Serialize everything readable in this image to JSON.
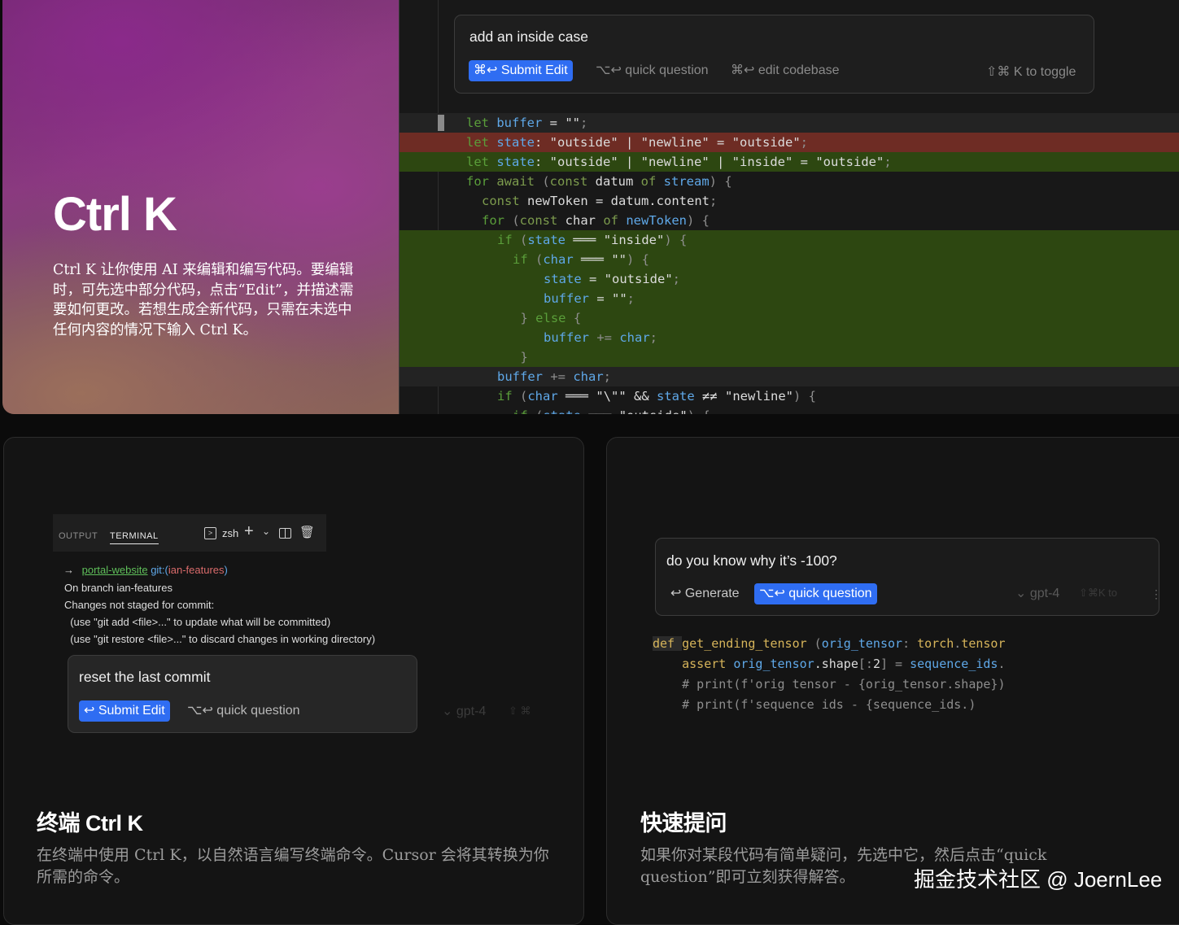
{
  "hero": {
    "title": "Ctrl K",
    "description": "Ctrl K 让你使用 AI 来编辑和编写代码。要编辑时，可先选中部分代码，点击“Edit”，并描述需要如何更改。若想生成全新代码，只需在未选中任何内容的情况下输入 Ctrl K。"
  },
  "editor": {
    "prompt": "add an inside case",
    "submit_label": "⌘↩ Submit Edit",
    "quick_question_label": "⌥↩ quick question",
    "edit_codebase_label": "⌘↩ edit codebase",
    "toggle_hint": "⇧⌘ K to toggle",
    "code_lines": [
      {
        "state": "hi",
        "indent": 0,
        "tokens": [
          [
            "kw",
            "let "
          ],
          [
            "vr",
            "buffer"
          ],
          [
            "pl",
            " = "
          ],
          [
            "st",
            "\"\""
          ],
          [
            "pu",
            ";"
          ]
        ]
      },
      {
        "state": "del",
        "indent": 0,
        "tokens": [
          [
            "kw",
            "let "
          ],
          [
            "vr",
            "state"
          ],
          [
            "pl",
            ": "
          ],
          [
            "st",
            "\"outside\""
          ],
          [
            "pl",
            " | "
          ],
          [
            "st",
            "\"newline\""
          ],
          [
            "pl",
            " = "
          ],
          [
            "st",
            "\"outside\""
          ],
          [
            "pu",
            ";"
          ]
        ]
      },
      {
        "state": "add",
        "indent": 0,
        "tokens": [
          [
            "kw",
            "let "
          ],
          [
            "vr",
            "state"
          ],
          [
            "pl",
            ": "
          ],
          [
            "st",
            "\"outside\""
          ],
          [
            "pl",
            " | "
          ],
          [
            "st",
            "\"newline\""
          ],
          [
            "pl",
            " | "
          ],
          [
            "st",
            "\"inside\""
          ],
          [
            "pl",
            " = "
          ],
          [
            "st",
            "\"outside\""
          ],
          [
            "pu",
            ";"
          ]
        ]
      },
      {
        "state": "",
        "indent": 0,
        "tokens": [
          [
            "kw",
            "for "
          ],
          [
            "kwd",
            "await "
          ],
          [
            "pu",
            "("
          ],
          [
            "kwd",
            "const "
          ],
          [
            "pl",
            "datum "
          ],
          [
            "kwd",
            "of "
          ],
          [
            "vr",
            "stream"
          ],
          [
            "pu",
            ") {"
          ]
        ]
      },
      {
        "state": "",
        "indent": 1,
        "tokens": [
          [
            "kwd",
            "const "
          ],
          [
            "pl",
            "newToken"
          ],
          [
            "pl",
            " = datum."
          ],
          [
            "pl",
            "content"
          ],
          [
            "pu",
            ";"
          ]
        ]
      },
      {
        "state": "",
        "indent": 1,
        "tokens": [
          [
            "kw",
            "for "
          ],
          [
            "pu",
            "("
          ],
          [
            "kwd",
            "const "
          ],
          [
            "pl",
            "char "
          ],
          [
            "kwd",
            "of "
          ],
          [
            "vr",
            "newToken"
          ],
          [
            "pu",
            ") {"
          ]
        ]
      },
      {
        "state": "add",
        "indent": 2,
        "tokens": [
          [
            "kw",
            "if "
          ],
          [
            "pu",
            "("
          ],
          [
            "vr",
            "state"
          ],
          [
            "pl",
            " ═══ "
          ],
          [
            "st",
            "\"inside\""
          ],
          [
            "pu",
            ") {"
          ]
        ]
      },
      {
        "state": "add",
        "indent": 3,
        "tokens": [
          [
            "kw",
            "if "
          ],
          [
            "pu",
            "("
          ],
          [
            "vr",
            "char"
          ],
          [
            "pl",
            " ═══ "
          ],
          [
            "st",
            "\"\""
          ],
          [
            "pu",
            ") {"
          ]
        ]
      },
      {
        "state": "add",
        "indent": 5,
        "tokens": [
          [
            "vr",
            "state"
          ],
          [
            "pl",
            " = "
          ],
          [
            "st",
            "\"outside\""
          ],
          [
            "pu",
            ";"
          ]
        ]
      },
      {
        "state": "add",
        "indent": 5,
        "tokens": [
          [
            "vr",
            "buffer"
          ],
          [
            "pl",
            " = "
          ],
          [
            "st",
            "\"\""
          ],
          [
            "pu",
            ";"
          ]
        ]
      },
      {
        "state": "add",
        "indent": 3.5,
        "tokens": [
          [
            "pu",
            "} "
          ],
          [
            "kw",
            "else "
          ],
          [
            "pu",
            "{"
          ]
        ]
      },
      {
        "state": "add",
        "indent": 5,
        "tokens": [
          [
            "vr",
            "buffer"
          ],
          [
            "pu",
            " += "
          ],
          [
            "vr",
            "char"
          ],
          [
            "pu",
            ";"
          ]
        ]
      },
      {
        "state": "add",
        "indent": 3.5,
        "tokens": [
          [
            "pu",
            "}"
          ]
        ]
      },
      {
        "state": "hi",
        "indent": 2,
        "tokens": [
          [
            "vr",
            "buffer"
          ],
          [
            "pu",
            " += "
          ],
          [
            "vr",
            "char"
          ],
          [
            "pu",
            ";"
          ]
        ]
      },
      {
        "state": "",
        "indent": 2,
        "tokens": [
          [
            "kw",
            "if "
          ],
          [
            "pu",
            "("
          ],
          [
            "vr",
            "char"
          ],
          [
            "pl",
            " ═══ "
          ],
          [
            "st",
            "\"\\\"\""
          ],
          [
            "pl",
            " && "
          ],
          [
            "vr",
            "state"
          ],
          [
            "pl",
            " ≠≠ "
          ],
          [
            "st",
            "\"newline\""
          ],
          [
            "pu",
            ") {"
          ]
        ]
      },
      {
        "state": "",
        "indent": 3,
        "tokens": [
          [
            "kw",
            "if "
          ],
          [
            "pu",
            "("
          ],
          [
            "vr",
            "state"
          ],
          [
            "pl",
            " ═══ "
          ],
          [
            "st",
            "\"outside\""
          ],
          [
            "pu",
            ") {"
          ]
        ]
      }
    ]
  },
  "terminal_card": {
    "tabs": {
      "output": "OUTPUT",
      "terminal": "TERMINAL"
    },
    "shell": "zsh",
    "prompt_arrow": "→",
    "prompt_dir": "portal-website",
    "prompt_git": "git:(",
    "prompt_branch": "ian-features",
    "prompt_git_end": ")",
    "lines": [
      "On branch ian-features",
      "Changes not staged for commit:",
      "  (use \"git add <file>...\" to update what will be committed)",
      "  (use \"git restore <file>...\" to discard changes in working directory)"
    ],
    "command": "reset the last commit",
    "submit_label": "↩ Submit Edit",
    "quick_question_label": "⌥↩ quick question",
    "model_hint": "⌄ gpt-4",
    "toggle_hint": "⇧ ⌘",
    "title": "终端 Ctrl K",
    "description": "在终端中使用 Ctrl K，以自然语言编写终端命令。Cursor 会将其转换为你所需的命令。"
  },
  "quick_card": {
    "question": "do you know why it’s -100?",
    "generate_label": "↩ Generate",
    "quick_question_label": "⌥↩ quick question",
    "model_hint": "⌄ gpt-4",
    "toggle_hint": "⇧⌘K to",
    "code_lines": [
      {
        "tokens": [
          [
            "yw",
            "def "
          ],
          [
            "yw",
            "get_ending_tensor"
          ],
          [
            "pu",
            " ("
          ],
          [
            "vr",
            "orig_tensor"
          ],
          [
            "pu",
            ": "
          ],
          [
            "yw",
            "torch"
          ],
          [
            "pu",
            "."
          ],
          [
            "yw",
            "tensor"
          ]
        ]
      },
      {
        "tokens": [
          [
            "pl",
            "    "
          ],
          [
            "yw",
            "assert "
          ],
          [
            "vr",
            "orig_tensor"
          ],
          [
            "pl",
            ".shape"
          ],
          [
            "pu",
            "["
          ],
          [
            "pu",
            ":"
          ],
          [
            "pl",
            "2"
          ],
          [
            "pu",
            "]"
          ],
          [
            "pu",
            " = "
          ],
          [
            "vr",
            "sequence_ids"
          ],
          [
            "pu",
            "."
          ]
        ]
      },
      {
        "tokens": [
          [
            "pu",
            "    # print(f'orig tensor - {orig_tensor.shape})"
          ]
        ]
      },
      {
        "tokens": [
          [
            "pu",
            "    # print(f'sequence ids - {sequence_ids.)"
          ]
        ]
      }
    ],
    "title": "快速提问",
    "description": "如果你对某段代码有简单疑问，先选中它，然后点击“quick question”即可立刻获得解答。"
  },
  "watermark": "掘金技术社区 @ JoernLee",
  "colors": {
    "accent": "#2f6df2",
    "added_line": "#2d4711",
    "removed_line": "#6e2c24"
  }
}
